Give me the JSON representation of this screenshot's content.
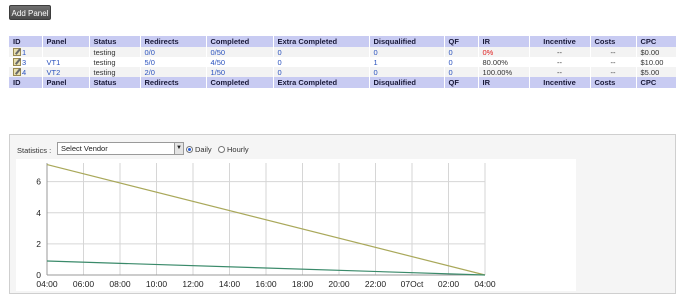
{
  "toolbar": {
    "add_panel_label": "Add Panel"
  },
  "table": {
    "headers": [
      "ID",
      "Panel",
      "Status",
      "Redirects",
      "Completed",
      "Extra Completed",
      "Disqualified",
      "QF",
      "IR",
      "Incentive",
      "Costs",
      "CPC"
    ],
    "rows": [
      {
        "id": "1",
        "panel": "",
        "status": "testing",
        "redirects": "0/0",
        "completed": "0/50",
        "extra_completed": "0",
        "disqualified": "0",
        "qf": "0",
        "ir": "0%",
        "incentive": "--",
        "costs": "--",
        "cpc": "$0.00"
      },
      {
        "id": "3",
        "panel": "VT1",
        "status": "testing",
        "redirects": "5/0",
        "completed": "4/50",
        "extra_completed": "0",
        "disqualified": "1",
        "qf": "0",
        "ir": "80.00%",
        "incentive": "--",
        "costs": "--",
        "cpc": "$10.00"
      },
      {
        "id": "4",
        "panel": "VT2",
        "status": "testing",
        "redirects": "2/0",
        "completed": "1/50",
        "extra_completed": "0",
        "disqualified": "0",
        "qf": "0",
        "ir": "100.00%",
        "incentive": "--",
        "costs": "--",
        "cpc": "$5.00"
      }
    ]
  },
  "statistics": {
    "label": "Statistics :",
    "vendor_select_value": "Select Vendor",
    "radio_daily": "Daily",
    "radio_hourly": "Hourly",
    "selected_mode": "daily"
  },
  "colors": {
    "header_bg": "#c8cbf2",
    "link": "#2a52be",
    "ir_zero": "#e02020",
    "series_a": "#a9a85a",
    "series_b": "#3a8a6a"
  },
  "chart_data": {
    "type": "line",
    "x_ticks": [
      "04:00",
      "06:00",
      "08:00",
      "10:00",
      "12:00",
      "14:00",
      "16:00",
      "18:00",
      "20:00",
      "22:00",
      "07Oct",
      "02:00",
      "04:00"
    ],
    "y_ticks": [
      0,
      2,
      4,
      6
    ],
    "ylim": [
      0,
      7.2
    ],
    "grid": true,
    "series": [
      {
        "color": "#a9a85a",
        "x": [
          "04:00",
          "04:00 (next day)"
        ],
        "values": [
          7.1,
          0
        ]
      },
      {
        "color": "#3a8a6a",
        "x": [
          "04:00",
          "04:00 (next day)"
        ],
        "values": [
          0.9,
          0
        ]
      }
    ]
  }
}
